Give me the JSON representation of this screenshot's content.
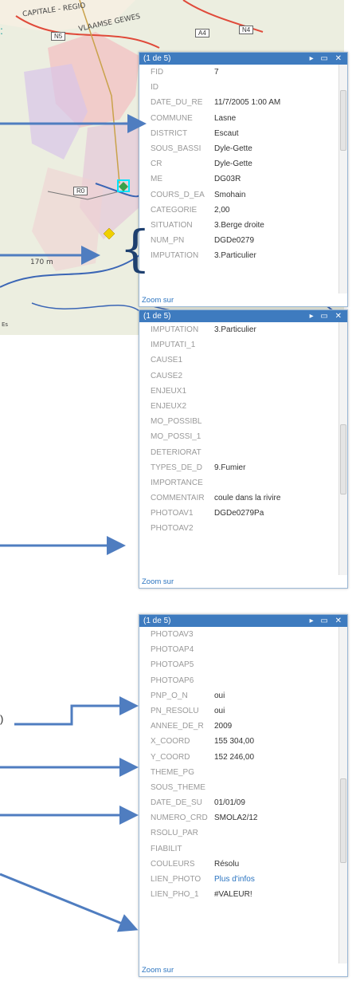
{
  "map": {
    "labels": [
      "CAPITALE - REGIO",
      "VLAAMSE GEWES"
    ],
    "road_shields": [
      "N5",
      "A4",
      "N4",
      "R0"
    ],
    "elevation": "170 m",
    "copyright": "Es",
    "colors": {
      "pink_region": "#f2c6c6",
      "purple_region": "#d9c5e8",
      "river": "#3a65b5",
      "road": "#e04a3a"
    }
  },
  "popups": [
    {
      "header": "(1 de 5)",
      "controls": "▸ ▭ ✕",
      "rows": [
        {
          "k": "FID",
          "v": "7"
        },
        {
          "k": "ID",
          "v": ""
        },
        {
          "k": "DATE_DU_RE",
          "v": "11/7/2005 1:00 AM"
        },
        {
          "k": "COMMUNE",
          "v": "Lasne"
        },
        {
          "k": "DISTRICT",
          "v": "Escaut"
        },
        {
          "k": "SOUS_BASSI",
          "v": "Dyle-Gette"
        },
        {
          "k": "CR",
          "v": "Dyle-Gette"
        },
        {
          "k": "ME",
          "v": "DG03R"
        },
        {
          "k": "COURS_D_EA",
          "v": "Smohain"
        },
        {
          "k": "CATEGORIE",
          "v": "2,00"
        },
        {
          "k": "SITUATION",
          "v": "3.Berge droite"
        },
        {
          "k": "NUM_PN",
          "v": "DGDe0279"
        },
        {
          "k": "IMPUTATION",
          "v": "3.Particulier"
        }
      ],
      "zoom": "Zoom sur"
    },
    {
      "header": "(1 de 5)",
      "controls": "▸ ▭ ✕",
      "rows": [
        {
          "k": "IMPUTATION",
          "v": "3.Particulier"
        },
        {
          "k": "IMPUTATI_1",
          "v": ""
        },
        {
          "k": "CAUSE1",
          "v": ""
        },
        {
          "k": "CAUSE2",
          "v": ""
        },
        {
          "k": "ENJEUX1",
          "v": ""
        },
        {
          "k": "ENJEUX2",
          "v": ""
        },
        {
          "k": "MO_POSSIBL",
          "v": ""
        },
        {
          "k": "MO_POSSI_1",
          "v": ""
        },
        {
          "k": "DETERIORAT",
          "v": ""
        },
        {
          "k": "TYPES_DE_D",
          "v": "9.Fumier"
        },
        {
          "k": "IMPORTANCE",
          "v": ""
        },
        {
          "k": "COMMENTAIR",
          "v": "coule dans la rivire"
        },
        {
          "k": "PHOTOAV1",
          "v": "DGDe0279Pa"
        },
        {
          "k": "PHOTOAV2",
          "v": ""
        }
      ],
      "zoom": "Zoom sur"
    },
    {
      "header": "(1 de 5)",
      "controls": "▸ ▭ ✕",
      "rows": [
        {
          "k": "PHOTOAV3",
          "v": ""
        },
        {
          "k": "PHOTOAP4",
          "v": ""
        },
        {
          "k": "PHOTOAP5",
          "v": ""
        },
        {
          "k": "PHOTOAP6",
          "v": ""
        },
        {
          "k": "PNP_O_N",
          "v": "oui"
        },
        {
          "k": "PN_RESOLU",
          "v": "oui"
        },
        {
          "k": "ANNEE_DE_R",
          "v": "2009"
        },
        {
          "k": "X_COORD",
          "v": "155 304,00"
        },
        {
          "k": "Y_COORD",
          "v": "152 246,00"
        },
        {
          "k": "THEME_PG",
          "v": ""
        },
        {
          "k": "SOUS_THEME",
          "v": ""
        },
        {
          "k": "DATE_DE_SU",
          "v": "01/01/09"
        },
        {
          "k": "NUMERO_CRD",
          "v": "SMOLA2/12"
        },
        {
          "k": "RSOLU_PAR",
          "v": ""
        },
        {
          "k": "FIABILIT",
          "v": ""
        },
        {
          "k": "COULEURS",
          "v": "Résolu"
        },
        {
          "k": "LIEN_PHOTO",
          "v": "Plus d'infos",
          "link": true
        },
        {
          "k": "LIEN_PHO_1",
          "v": "#VALEUR!"
        }
      ],
      "zoom": "Zoom sur"
    }
  ],
  "external": {
    "paren_label": ")",
    "green_mark": ":"
  },
  "accent": "#3e7bbf",
  "arrow_color": "#4f7dc0"
}
